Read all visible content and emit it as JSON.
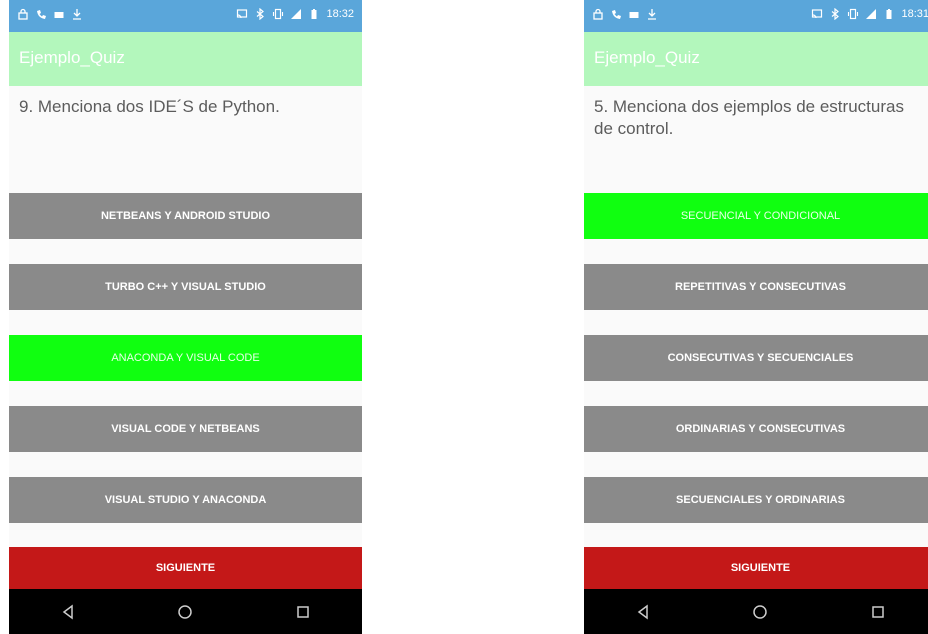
{
  "status_bar": {
    "left_time": "18:32",
    "right_time": "18:31",
    "icons": [
      "lock-icon",
      "phone-icon",
      "image-icon",
      "download-icon",
      "cast-icon",
      "bluetooth-icon",
      "vibrate-icon",
      "signal-icon",
      "battery-icon"
    ]
  },
  "left_screen": {
    "app_title": "Ejemplo_Quiz",
    "question": "9. Menciona dos IDE´S de Python.",
    "answers": [
      "NETBEANS Y ANDROID STUDIO",
      "TURBO C++ Y VISUAL STUDIO",
      "ANACONDA Y VISUAL CODE",
      "VISUAL CODE Y NETBEANS",
      "VISUAL STUDIO Y ANACONDA"
    ],
    "selected_index": 2,
    "next_label": "SIGUIENTE"
  },
  "right_screen": {
    "app_title": "Ejemplo_Quiz",
    "question": "5. Menciona dos ejemplos de estructuras de control.",
    "answers": [
      "SECUENCIAL Y CONDICIONAL",
      "REPETITIVAS Y CONSECUTIVAS",
      "CONSECUTIVAS Y SECUENCIALES",
      "ORDINARIAS Y CONSECUTIVAS",
      "SECUENCIALES Y ORDINARIAS"
    ],
    "selected_index": 0,
    "next_label": "SIGUIENTE"
  },
  "colors": {
    "status_bar": "#5aa6da",
    "app_bar": "#b3f7bc",
    "answer_default": "#8a8a8a",
    "answer_selected": "#10ff10",
    "next_button": "#c41818",
    "nav_bar": "#000000"
  },
  "nav_icons": [
    "back-icon",
    "home-icon",
    "recents-icon"
  ]
}
